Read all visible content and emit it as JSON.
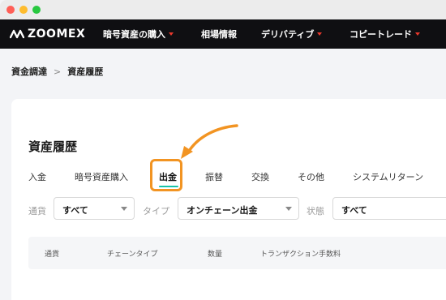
{
  "window": {
    "controls": [
      "close",
      "minimize",
      "zoom"
    ],
    "colors": {
      "close": "#ff5f57",
      "minimize": "#febc2e",
      "zoom": "#28c840"
    }
  },
  "nav": {
    "logo_text": "ZOOMEX",
    "items": [
      {
        "label": "暗号資産の購入",
        "has_dropdown": true
      },
      {
        "label": "相場情報",
        "has_dropdown": false
      },
      {
        "label": "デリバティブ",
        "has_dropdown": true
      },
      {
        "label": "コピートレード",
        "has_dropdown": true
      }
    ],
    "background": "#0f0f12",
    "caret_color": "#e8382c"
  },
  "breadcrumb": {
    "items": [
      "資金調達",
      "資産履歴"
    ],
    "separator": ">"
  },
  "page": {
    "title": "資産履歴"
  },
  "tabs": {
    "items": [
      "入金",
      "暗号資産購入",
      "出金",
      "振替",
      "交換",
      "その他",
      "システムリターン"
    ],
    "active_index": 2,
    "active_color": "#17c3a8",
    "highlight_color": "#f29422"
  },
  "filters": [
    {
      "label": "通貨",
      "value": "すべて"
    },
    {
      "label": "タイプ",
      "value": "オンチェーン出金"
    },
    {
      "label": "状態",
      "value": "すべて"
    }
  ],
  "table": {
    "columns": [
      "通貨",
      "チェーンタイプ",
      "数量",
      "トランザクション手数料"
    ]
  }
}
